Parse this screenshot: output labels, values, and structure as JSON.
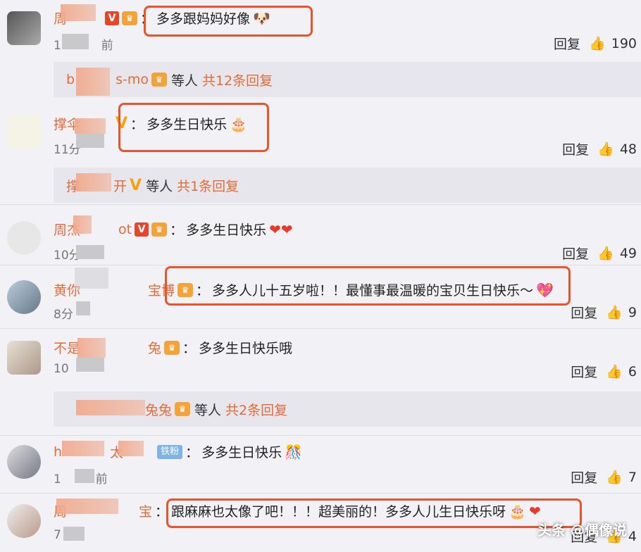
{
  "comments": [
    {
      "name": "周",
      "content": "多多跟妈妈好像",
      "time": "1",
      "time_tail": "前",
      "reply_label": "回复",
      "likes": "190",
      "replies_summary": {
        "name": "b",
        "name_tail": "s-mo",
        "etc": "等人",
        "count": "共12条回复"
      }
    },
    {
      "name": "撑伞",
      "content": "多多生日快乐",
      "time": "11分",
      "reply_label": "回复",
      "likes": "48",
      "replies_summary": {
        "name": "撑",
        "name_tail": "开",
        "etc": "等人",
        "count": "共1条回复"
      }
    },
    {
      "name": "周杰",
      "name_tail": "ot",
      "content": "多多生日快乐",
      "time": "10分",
      "reply_label": "回复",
      "likes": "49"
    },
    {
      "name": "黄你",
      "name_tail": "宝博",
      "content": "多多人儿十五岁啦！！最懂事最温暖的宝贝生日快乐～",
      "time": "8分",
      "reply_label": "回复",
      "likes": "9"
    },
    {
      "name": "不是",
      "name_tail": "兔",
      "content": "多多生日快乐哦",
      "time": "10",
      "reply_label": "回复",
      "likes": "6",
      "replies_summary": {
        "name": "",
        "name_tail": "兔兔",
        "etc": "等人",
        "count": "共2条回复"
      }
    },
    {
      "name": "h",
      "name_tail": "太",
      "fans_badge": "铁粉",
      "content": "多多生日快乐",
      "time": "1",
      "time_tail": "前",
      "reply_label": "回复",
      "likes": "7"
    },
    {
      "name": "周",
      "name_tail": "宝",
      "content": "跟麻麻也太像了吧！！！超美丽的！多多人儿生日快乐呀",
      "time": "7",
      "reply_label": "回复",
      "likes": "4"
    }
  ],
  "watermark": "头条 @偶像说",
  "colors": {
    "accent": "#e06c3a",
    "highlight": "#e9542a",
    "background": "#f2f1f6"
  },
  "icons": {
    "like": "thumbs-up-icon",
    "verified": "v-badge-icon",
    "crown": "crown-badge-icon"
  }
}
